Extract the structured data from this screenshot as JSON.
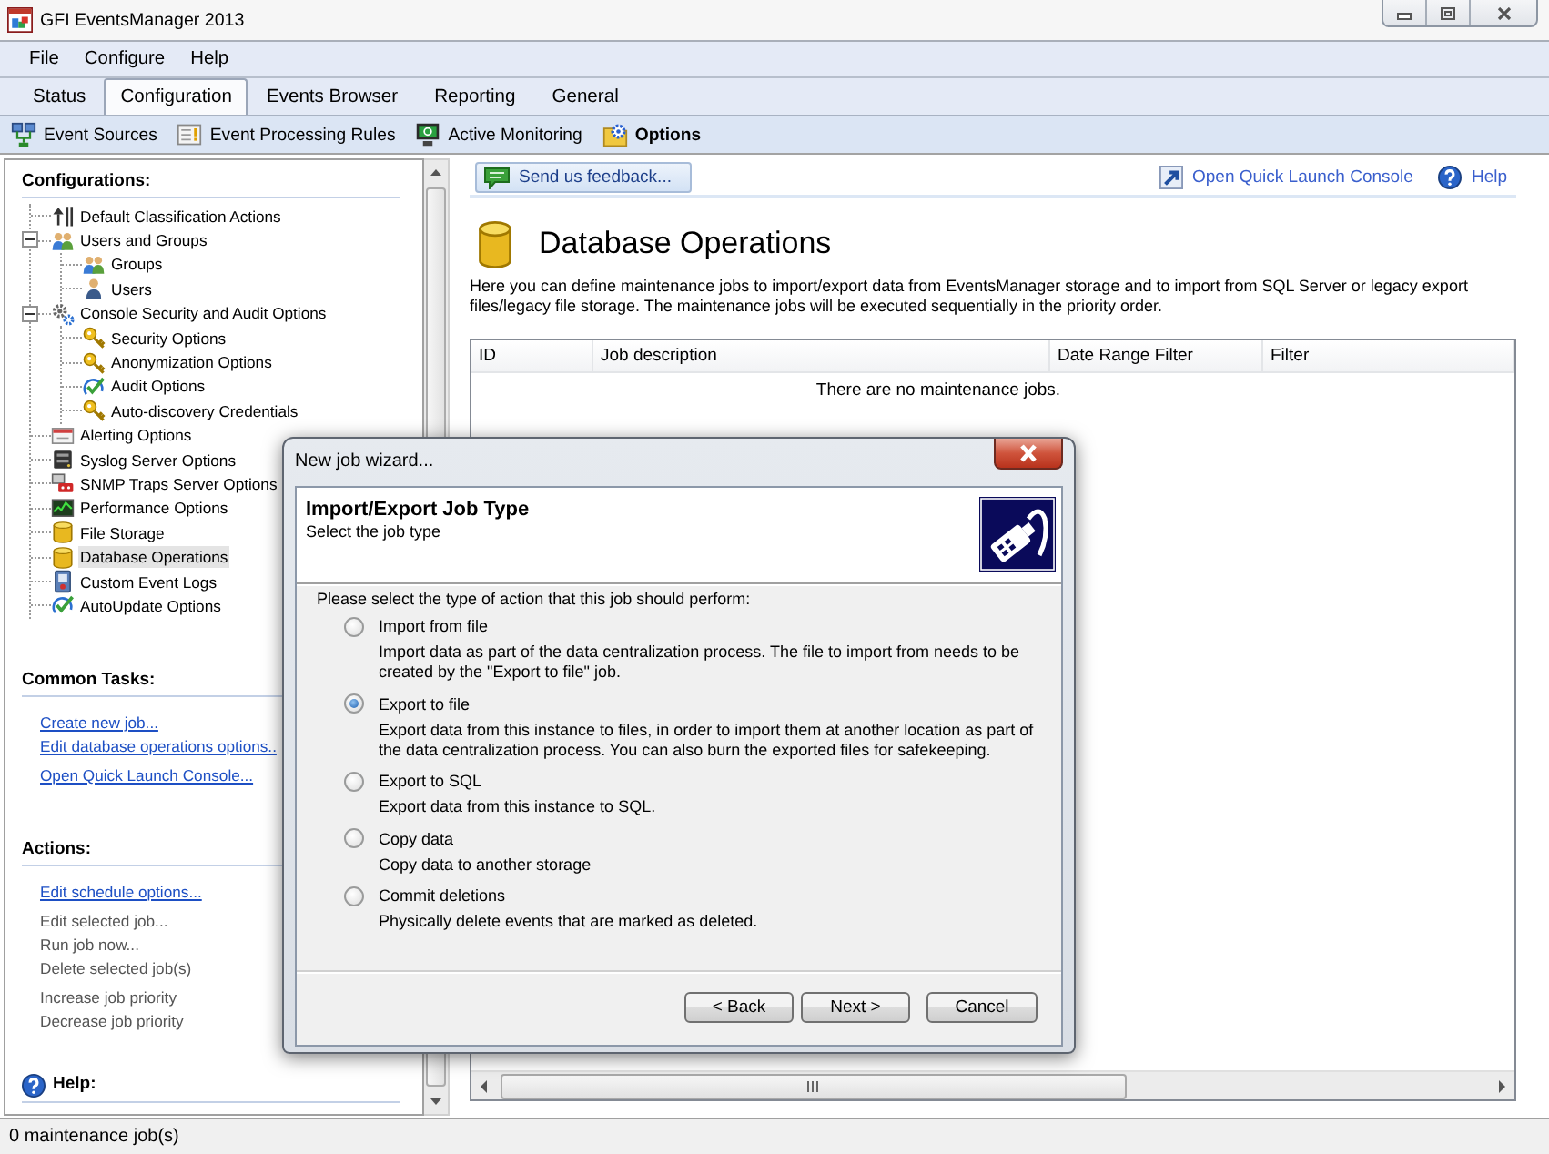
{
  "window": {
    "title": "GFI EventsManager 2013"
  },
  "menu": [
    "File",
    "Configure",
    "Help"
  ],
  "tabs": [
    {
      "label": "Status",
      "selected": false
    },
    {
      "label": "Configuration",
      "selected": true
    },
    {
      "label": "Events Browser",
      "selected": false
    },
    {
      "label": "Reporting",
      "selected": false
    },
    {
      "label": "General",
      "selected": false
    }
  ],
  "toolbar": [
    {
      "label": "Event Sources",
      "selected": false
    },
    {
      "label": "Event Processing Rules",
      "selected": false
    },
    {
      "label": "Active Monitoring",
      "selected": false
    },
    {
      "label": "Options",
      "selected": true
    }
  ],
  "sidebar": {
    "configurations": {
      "heading": "Configurations:",
      "tree": [
        {
          "label": "Default Classification Actions",
          "selected": false
        },
        {
          "label": "Users and Groups",
          "selected": false,
          "expanded": true,
          "children": [
            {
              "label": "Groups",
              "selected": false
            },
            {
              "label": "Users",
              "selected": false
            }
          ]
        },
        {
          "label": "Console Security and Audit Options",
          "selected": false,
          "expanded": true,
          "children": [
            {
              "label": "Security Options",
              "selected": false
            },
            {
              "label": "Anonymization Options",
              "selected": false
            },
            {
              "label": "Audit Options",
              "selected": false
            },
            {
              "label": "Auto-discovery Credentials",
              "selected": false
            }
          ]
        },
        {
          "label": "Alerting Options",
          "selected": false
        },
        {
          "label": "Syslog Server Options",
          "selected": false
        },
        {
          "label": "SNMP Traps Server Options",
          "selected": false
        },
        {
          "label": "Performance Options",
          "selected": false
        },
        {
          "label": "File Storage",
          "selected": false
        },
        {
          "label": "Database Operations",
          "selected": true
        },
        {
          "label": "Custom Event Logs",
          "selected": false
        },
        {
          "label": "AutoUpdate Options",
          "selected": false
        }
      ]
    },
    "common_tasks": {
      "heading": "Common Tasks:",
      "groups": [
        [
          "Create new job...",
          "Edit database operations options.."
        ],
        [
          "Open Quick Launch Console..."
        ]
      ]
    },
    "actions": {
      "heading": "Actions:",
      "groups": [
        [
          {
            "label": "Edit schedule options...",
            "disabled": false
          }
        ],
        [
          {
            "label": "Edit selected job...",
            "disabled": true
          },
          {
            "label": "Run job now...",
            "disabled": true
          },
          {
            "label": "Delete selected job(s)",
            "disabled": true
          }
        ],
        [
          {
            "label": "Increase job priority",
            "disabled": true
          },
          {
            "label": "Decrease job priority",
            "disabled": true
          }
        ]
      ]
    },
    "help": {
      "heading": "Help:"
    }
  },
  "content": {
    "feedback_button": "Send us feedback...",
    "links": [
      "Open Quick Launch Console",
      "Help"
    ],
    "title": "Database Operations",
    "description": "Here you can define maintenance jobs to import/export data from EventsManager storage and to import from SQL Server or legacy export files/legacy file storage. The maintenance jobs will be executed sequentially in the priority order.",
    "table": {
      "columns": [
        "ID",
        "Job description",
        "Date Range Filter",
        "Filter"
      ],
      "empty_message": "There are no maintenance jobs."
    }
  },
  "dialog": {
    "title": "New job wizard...",
    "heading": "Import/Export Job Type",
    "subheading": "Select the job type",
    "prompt": "Please select the type of action that this job should perform:",
    "options": [
      {
        "label": "Import from file",
        "description": "Import data as part of the data centralization process. The file to import from needs to be created by the \"Export to file\" job.",
        "selected": false
      },
      {
        "label": "Export to file",
        "description": "Export data from this instance to files, in order to import them at another location as part of the data centralization process. You can also burn the exported files for safekeeping.",
        "selected": true
      },
      {
        "label": "Export to SQL",
        "description": "Export data from this instance to SQL.",
        "selected": false
      },
      {
        "label": "Copy data",
        "description": "Copy data to another storage",
        "selected": false
      },
      {
        "label": "Commit deletions",
        "description": "Physically delete events that are marked as deleted.",
        "selected": false
      }
    ],
    "buttons": [
      "< Back",
      "Next >",
      "Cancel"
    ]
  },
  "status_bar": "0 maintenance job(s)"
}
